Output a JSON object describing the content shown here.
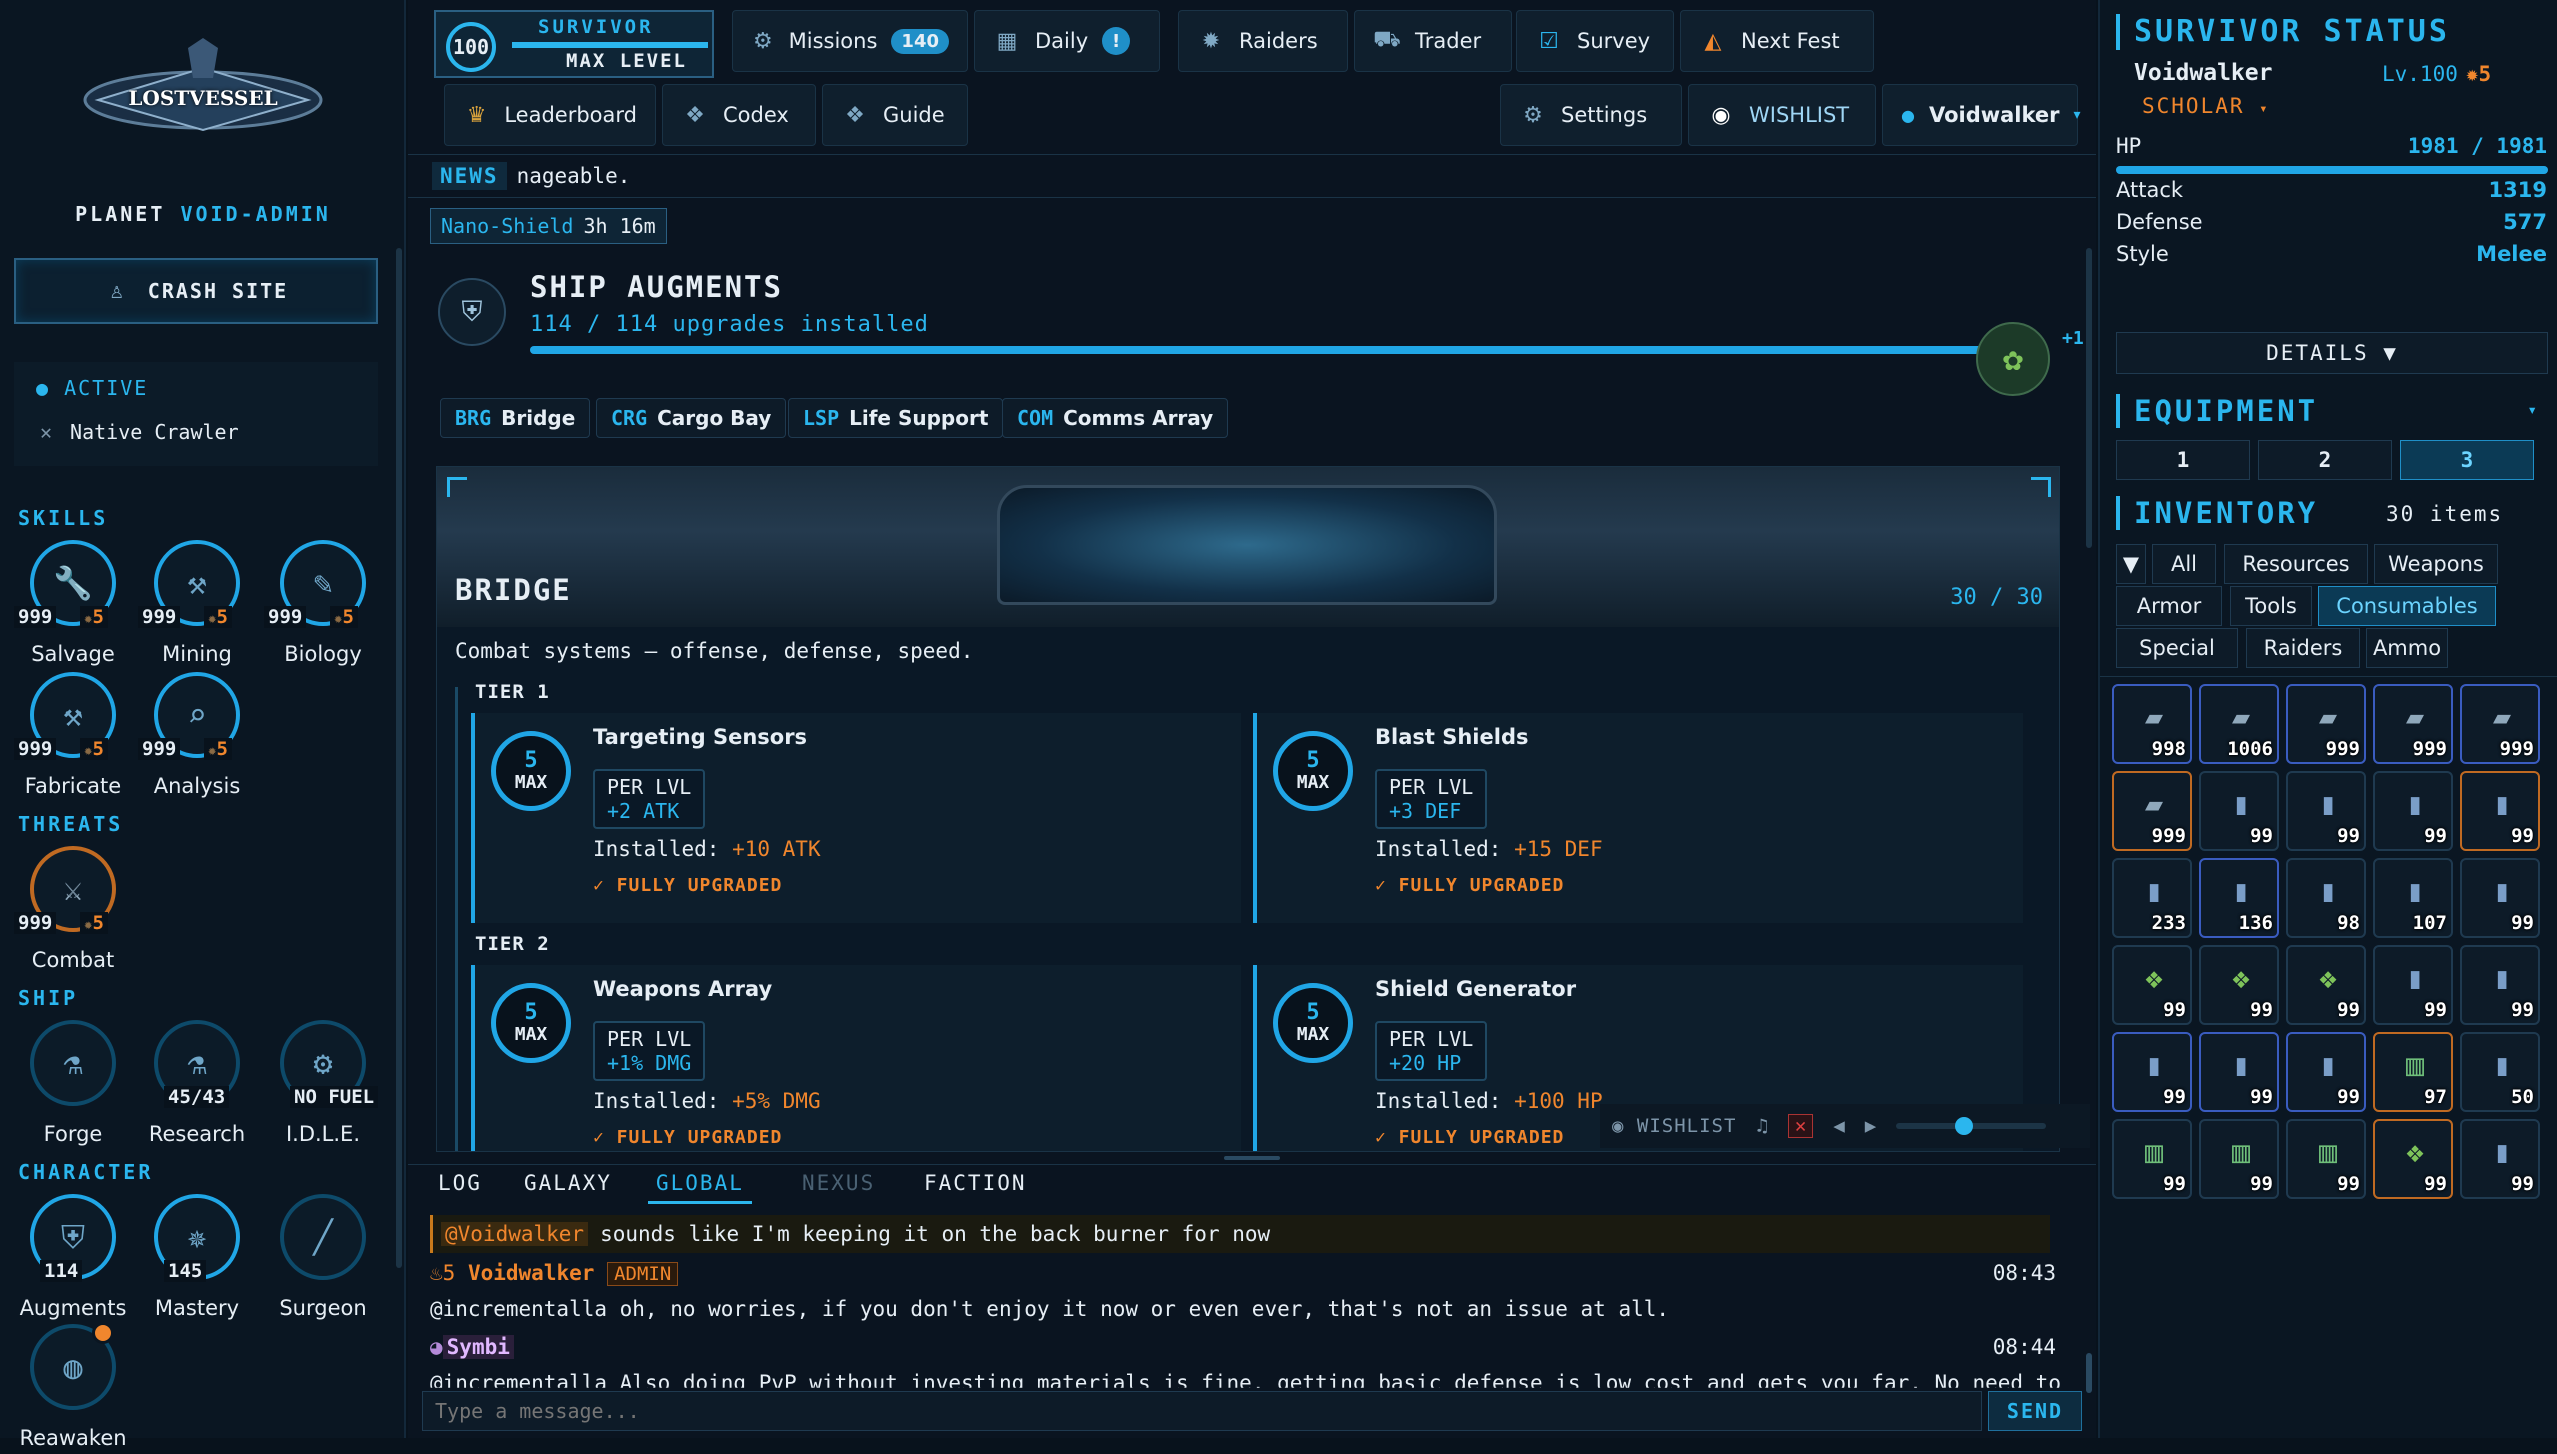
{
  "logo": {
    "text": "LOSTVESSEL"
  },
  "planet": {
    "label": "PLANET",
    "name": "VOID-ADMIN"
  },
  "crash_site": {
    "label": "CRASH SITE"
  },
  "active": {
    "label": "ACTIVE",
    "item": "Native Crawler"
  },
  "skills": {
    "title": "SKILLS",
    "items": [
      {
        "name": "Salvage",
        "value": "999",
        "badge": "5",
        "icon": "wrench-icon"
      },
      {
        "name": "Mining",
        "value": "999",
        "badge": "5",
        "icon": "pickaxe-icon"
      },
      {
        "name": "Biology",
        "value": "999",
        "badge": "5",
        "icon": "syringe-icon"
      },
      {
        "name": "Fabricate",
        "value": "999",
        "badge": "5",
        "icon": "anvil-icon"
      },
      {
        "name": "Analysis",
        "value": "999",
        "badge": "5",
        "icon": "magnifier-icon"
      }
    ]
  },
  "threats": {
    "title": "THREATS",
    "items": [
      {
        "name": "Combat",
        "value": "999",
        "badge": "5",
        "icon": "crossed-swords-icon"
      }
    ]
  },
  "ship": {
    "title": "SHIP",
    "items": [
      {
        "name": "Forge",
        "value": "",
        "icon": "forge-icon"
      },
      {
        "name": "Research",
        "value": "45/43",
        "icon": "flask-icon"
      },
      {
        "name": "I.D.L.E.",
        "value": "NO FUEL",
        "icon": "engine-icon"
      }
    ]
  },
  "character": {
    "title": "CHARACTER",
    "items": [
      {
        "name": "Augments",
        "value": "114",
        "icon": "shield-icon"
      },
      {
        "name": "Mastery",
        "value": "145",
        "icon": "compass-icon"
      },
      {
        "name": "Surgeon",
        "value": "",
        "icon": "scalpel-icon"
      },
      {
        "name": "Reawaken",
        "value": "",
        "icon": "planet-icon"
      }
    ]
  },
  "topbar": {
    "level": "100",
    "survivor": "SURVIVOR",
    "max_level": "MAX LEVEL",
    "missions": "Missions",
    "missions_count": "140",
    "daily": "Daily",
    "daily_badge": "!",
    "raiders": "Raiders",
    "trader": "Trader",
    "survey": "Survey",
    "next_fest": "Next Fest",
    "leaderboard": "Leaderboard",
    "codex": "Codex",
    "guide": "Guide",
    "settings": "Settings",
    "wishlist": "WISHLIST",
    "user": "Voidwalker"
  },
  "news": {
    "label": "NEWS",
    "text": "nageable."
  },
  "buff": {
    "name": "Nano-Shield",
    "time": "3h 16m"
  },
  "augments": {
    "title": "SHIP AUGMENTS",
    "progress": "114 / 114 upgrades installed",
    "progress_fraction": 1.0,
    "plus": "+1"
  },
  "sections": [
    {
      "code": "BRG",
      "name": "Bridge"
    },
    {
      "code": "CRG",
      "name": "Cargo Bay"
    },
    {
      "code": "LSP",
      "name": "Life Support"
    },
    {
      "code": "COM",
      "name": "Comms Array"
    }
  ],
  "bridge": {
    "title": "BRIDGE",
    "count": "30 / 30",
    "desc": "Combat systems — offense, defense, speed.",
    "tier1": "TIER 1",
    "tier2": "TIER 2",
    "cards": [
      {
        "name": "Targeting Sensors",
        "level": "5",
        "max": "MAX",
        "per": "PER LVL",
        "per_val": "+2 ATK",
        "installed_label": "Installed:",
        "installed": "+10 ATK",
        "status": "✓ FULLY UPGRADED"
      },
      {
        "name": "Blast Shields",
        "level": "5",
        "max": "MAX",
        "per": "PER LVL",
        "per_val": "+3 DEF",
        "installed_label": "Installed:",
        "installed": "+15 DEF",
        "status": "✓ FULLY UPGRADED"
      },
      {
        "name": "Weapons Array",
        "level": "5",
        "max": "MAX",
        "per": "PER LVL",
        "per_val": "+1% DMG",
        "installed_label": "Installed:",
        "installed": "+5% DMG",
        "status": "✓ FULLY UPGRADED"
      },
      {
        "name": "Shield Generator",
        "level": "5",
        "max": "MAX",
        "per": "PER LVL",
        "per_val": "+20 HP",
        "installed_label": "Installed:",
        "installed": "+100 HP",
        "status": "✓ FULLY UPGRADED"
      }
    ]
  },
  "player": {
    "wishlist": "WISHLIST",
    "volume_fraction": 0.45
  },
  "chat": {
    "tabs": [
      "LOG",
      "GALAXY",
      "GLOBAL",
      "NEXUS",
      "FACTION"
    ],
    "active_tab": "GLOBAL",
    "reply": {
      "mention": "@Voidwalker",
      "text": "sounds like I'm keeping it on the back burner for now"
    },
    "messages": [
      {
        "badge": "5",
        "name": "Voidwalker",
        "role": "ADMIN",
        "time": "08:43",
        "text": "@incrementalla oh, no worries, if you don't enjoy it now or even ever, that's not an issue at all."
      },
      {
        "badge": "",
        "name": "Symbi",
        "role": "",
        "time": "08:44",
        "text": "@incrementalla Also doing PvP without investing materials is fine, getting basic defense is low cost and gets you far. No need to"
      }
    ],
    "placeholder": "Type a message...",
    "send": "SEND"
  },
  "status": {
    "title": "SURVIVOR STATUS",
    "name": "Voidwalker",
    "level": "Lv.100",
    "badge": "5",
    "class": "SCHOLAR",
    "hp_label": "HP",
    "hp": "1981 / 1981",
    "hp_fraction": 1.0,
    "stats": [
      {
        "label": "Attack",
        "value": "1319"
      },
      {
        "label": "Defense",
        "value": "577"
      },
      {
        "label": "Style",
        "value": "Melee"
      }
    ],
    "details": "DETAILS ▼"
  },
  "equipment": {
    "title": "EQUIPMENT",
    "slots": [
      "1",
      "2",
      "3"
    ],
    "active_slot": "3"
  },
  "inventory": {
    "title": "INVENTORY",
    "count": "30 items",
    "filters": [
      "▼",
      "All",
      "Resources",
      "Weapons",
      "Armor",
      "Tools",
      "Consumables",
      "Special",
      "Raiders",
      "Ammo"
    ],
    "active_filter": "Consumables",
    "items": [
      {
        "q": "998",
        "icon": "ship-icon"
      },
      {
        "q": "1006",
        "icon": "ship-icon"
      },
      {
        "q": "999",
        "icon": "ship-icon"
      },
      {
        "q": "999",
        "icon": "ship-icon"
      },
      {
        "q": "999",
        "icon": "ship-icon"
      },
      {
        "q": "999",
        "icon": "ship-icon"
      },
      {
        "q": "99",
        "icon": "ammo-icon"
      },
      {
        "q": "99",
        "icon": "ammo-icon"
      },
      {
        "q": "99",
        "icon": "ammo-icon"
      },
      {
        "q": "99",
        "icon": "ammo-icon"
      },
      {
        "q": "233",
        "icon": "ammo-icon"
      },
      {
        "q": "136",
        "icon": "ammo-icon"
      },
      {
        "q": "98",
        "icon": "ammo-icon"
      },
      {
        "q": "107",
        "icon": "ammo-icon"
      },
      {
        "q": "99",
        "icon": "ammo-icon"
      },
      {
        "q": "99",
        "icon": "crystal-icon"
      },
      {
        "q": "99",
        "icon": "crystal-icon"
      },
      {
        "q": "99",
        "icon": "crystal-icon"
      },
      {
        "q": "99",
        "icon": "ammo-icon"
      },
      {
        "q": "99",
        "icon": "ammo-icon"
      },
      {
        "q": "99",
        "icon": "ammo-icon"
      },
      {
        "q": "99",
        "icon": "ammo-icon"
      },
      {
        "q": "99",
        "icon": "ammo-icon"
      },
      {
        "q": "97",
        "icon": "canister-icon"
      },
      {
        "q": "50",
        "icon": "ammo-icon"
      },
      {
        "q": "99",
        "icon": "canister-icon"
      },
      {
        "q": "99",
        "icon": "canister-icon"
      },
      {
        "q": "99",
        "icon": "canister-icon"
      },
      {
        "q": "99",
        "icon": "crystal-icon"
      },
      {
        "q": "99",
        "icon": "ammo-icon"
      }
    ]
  }
}
